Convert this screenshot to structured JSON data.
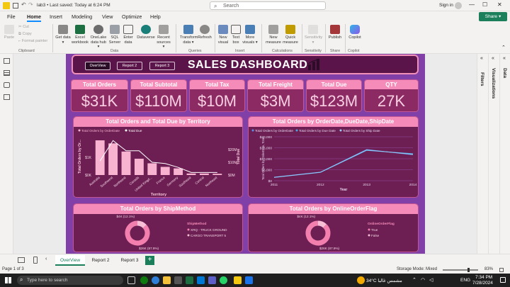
{
  "window": {
    "title": "lab3 • Last saved: Today at 6:24 PM",
    "search_placeholder": "Search",
    "user": "Sign in"
  },
  "menu": {
    "items": [
      "File",
      "Home",
      "Insert",
      "Modeling",
      "View",
      "Optimize",
      "Help"
    ],
    "active": "Home",
    "share_label": "Share"
  },
  "ribbon": {
    "clipboard": {
      "paste": "Paste",
      "cut": "Cut",
      "copy": "Copy",
      "format_painter": "Format painter",
      "group": "Clipboard"
    },
    "data": {
      "get_data": "Get data",
      "excel": "Excel workbook",
      "onelake": "OneLake data hub",
      "sql": "SQL Server",
      "enter": "Enter data",
      "dataverse": "Dataverse",
      "recent": "Recent sources",
      "group": "Data"
    },
    "queries": {
      "transform": "Transform data",
      "refresh": "Refresh",
      "group": "Queries"
    },
    "insert": {
      "new_visual": "New visual",
      "text_box": "Text box",
      "more_visuals": "More visuals",
      "group": "Insert"
    },
    "calculations": {
      "new_measure": "New measure",
      "quick_measure": "Quick measure",
      "group": "Calculations"
    },
    "sensitivity": {
      "label": "Sensitivity",
      "group": "Sensitivity"
    },
    "share": {
      "publish": "Publish",
      "group": "Share"
    },
    "copilot": {
      "label": "Copilot",
      "group": "Copilot"
    }
  },
  "panes": {
    "filters": "Filters",
    "visualizations": "Visualizations",
    "data": "Data"
  },
  "report": {
    "nav": [
      "OverView",
      "Report 2",
      "Report 3"
    ],
    "title": "SALES DASHBOARD",
    "kpis": [
      {
        "label": "Total Orders",
        "value": "$31K"
      },
      {
        "label": "Total Subtotal",
        "value": "$110M"
      },
      {
        "label": "Total Tax",
        "value": "$10M"
      },
      {
        "label": "Total Freight",
        "value": "$3M"
      },
      {
        "label": "Total Due",
        "value": "$123M"
      },
      {
        "label": "QTY",
        "value": "27K"
      }
    ],
    "colors": {
      "canvas": "#8040a8",
      "card": "#6d1f53",
      "accent": "#f58bb8",
      "header": "#5a1449"
    }
  },
  "chart_data": [
    {
      "type": "bar",
      "title": "Total Orders and Total Due by Territory",
      "legend": [
        "Total Orders by OrderDate",
        "Total Due"
      ],
      "xlabel": "Territory",
      "ylabel": "Total Orders by Or...",
      "y2label": "Total Due",
      "categories": [
        "Australia",
        "Southwest",
        "Northwest",
        "Canada",
        "United Kingd...",
        "France",
        "Germany",
        "Southeast",
        "Central",
        "Northeast"
      ],
      "series": [
        {
          "name": "Total Orders by OrderDate",
          "values": [
            6800,
            6200,
            4600,
            3200,
            2300,
            1600,
            1300,
            300,
            300,
            250
          ]
        },
        {
          "name": "Total Due",
          "values": [
            11,
            27,
            19,
            19,
            10,
            9,
            6,
            2,
            2,
            2
          ]
        }
      ],
      "y_ticks": [
        "$0K",
        "$1K"
      ],
      "y2_ticks": [
        "$0M",
        "$10M",
        "$20M"
      ]
    },
    {
      "type": "line",
      "title": "Total Orders by OrderDate,DueDate,ShipDate",
      "legend": [
        "Total Orders by OrderDate",
        "Total Orders by Due Date",
        "Total Orders by Ship Date"
      ],
      "xlabel": "Year",
      "ylabel": "Total Orders by OrderDate, Total",
      "x": [
        "2011",
        "2012",
        "2013",
        "2014"
      ],
      "series": [
        {
          "name": "Total Orders by OrderDate",
          "values": [
            1600,
            3900,
            14200,
            11800
          ]
        },
        {
          "name": "Total Orders by Due Date",
          "values": [
            1500,
            3800,
            13800,
            12300
          ]
        },
        {
          "name": "Total Orders by Ship Date",
          "values": [
            1550,
            3850,
            14000,
            12000
          ]
        }
      ],
      "y_ticks": [
        "$0",
        "$5,000",
        "$10,000",
        "$15,000",
        "$20,000"
      ],
      "ylim": [
        0,
        20000
      ]
    },
    {
      "type": "pie",
      "title": "Total Orders by ShipMethod",
      "legend_title": "ShipMethod",
      "slices": [
        {
          "label": "XRQ - TRUCK GROUND",
          "value": 26.6,
          "text": "$26K (87.9%)"
        },
        {
          "label": "CARGO TRANSPORT 5",
          "value": 4.0,
          "text": "$4K (12.1%)"
        }
      ]
    },
    {
      "type": "pie",
      "title": "Total Orders by OnlineOrderFlag",
      "legend_title": "OnlineOrderFlag",
      "slices": [
        {
          "label": "True",
          "value": 27.3,
          "text": "$26K (87.9%)"
        },
        {
          "label": "False",
          "value": 3.7,
          "text": "$4K (12.1%)"
        }
      ]
    }
  ],
  "pages": {
    "tabs": [
      "OverView",
      "Report 2",
      "Report 3"
    ],
    "active": "OverView",
    "add": "+"
  },
  "status": {
    "page": "Page 1 of 3",
    "storage": "Storage Mode: Mixed",
    "zoom": "83%"
  },
  "taskbar": {
    "search": "Type here to search",
    "weather": "34°C مشمس غالبا",
    "lang": "ENG",
    "time": "7:34 PM",
    "date": "7/28/2024"
  }
}
